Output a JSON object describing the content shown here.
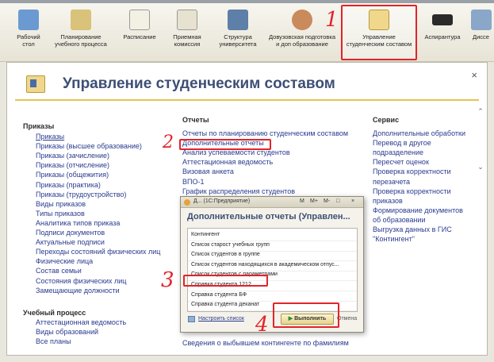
{
  "toolbar": {
    "items": [
      {
        "label": "Рабочий\nстол",
        "icon": "desktop-icon"
      },
      {
        "label": "Планирование\nучебного процесса",
        "icon": "planning-icon"
      },
      {
        "label": "Расписание",
        "icon": "calendar-icon"
      },
      {
        "label": "Приемная\nкомиссия",
        "icon": "admission-icon"
      },
      {
        "label": "Структура\nуниверситета",
        "icon": "structure-icon"
      },
      {
        "label": "Довузовская подготовка\nи доп образование",
        "icon": "person-icon"
      },
      {
        "label": "Управление\nстуденческим составом",
        "icon": "students-icon"
      },
      {
        "label": "Аспирантура",
        "icon": "graduate-cap-icon"
      },
      {
        "label": "Диссе",
        "icon": "dissertation-icon"
      }
    ]
  },
  "panel": {
    "title": "Управление студенческим составом",
    "close": "×"
  },
  "left": {
    "header1": "Приказы",
    "links1": [
      "Приказы",
      "Приказы (высшее образование)",
      "Приказы (зачисление)",
      "Приказы (отчисление)",
      "Приказы (общежития)",
      "Приказы (практика)",
      "Приказы (трудоустройство)",
      "Виды приказов",
      "Типы приказов",
      "Аналитика типов приказа",
      "Подписи документов",
      "Актуальные подписи",
      "Переходы состояний физических лиц",
      "Физические лица",
      "Состав семьи",
      "Состояния физических лиц",
      "Замещающие должности"
    ],
    "header2": "Учебный процесс",
    "links2": [
      "Аттестационная ведомость",
      "Виды образований",
      "Все планы"
    ]
  },
  "middle": {
    "header": "Отчеты",
    "links": [
      "Отчеты по планированию студенческим составом",
      "Дополнительные отчеты",
      "Анализ успеваемости студентов",
      "Аттестационная ведомость",
      "Визовая анкета",
      "ВПО-1",
      "График распределения студентов"
    ],
    "bottom_link": "Сведения о выбывшем контингенте по фамилиям"
  },
  "right": {
    "header": "Сервис",
    "links": [
      "Дополнительные обработки",
      "Перевод в другое",
      "подразделение",
      "Пересчет оценок",
      "Проверка корректности",
      "перезачета",
      "Проверка корректности",
      "приказов",
      "Формирование документов",
      "об образовании",
      "Выгрузка данных в ГИС",
      "\"Контингент\""
    ]
  },
  "dialog": {
    "titlebar": "Д... (1С:Предприятие)",
    "titlebar_buttons": [
      "M",
      "M+",
      "M-",
      "□",
      "×"
    ],
    "title": "Дополнительные отчеты (Управлен...",
    "items": [
      "Контингент",
      "Список старост учебных групп",
      "Список студентов в группе",
      "Список студентов находящихся в академическом отпус...",
      "Список студентов с параметрами",
      "Справка студента 1212",
      "Справка студента БФ",
      "Справка студента деканат"
    ],
    "settings_link": "Настроить список",
    "run_button": "Выполнить",
    "cancel": "Отмена"
  },
  "annotations": [
    "1",
    "2",
    "3",
    "4"
  ],
  "colors": {
    "accent": "#3d4f75",
    "link": "#2a3b8f",
    "annotation": "#e2232a"
  }
}
